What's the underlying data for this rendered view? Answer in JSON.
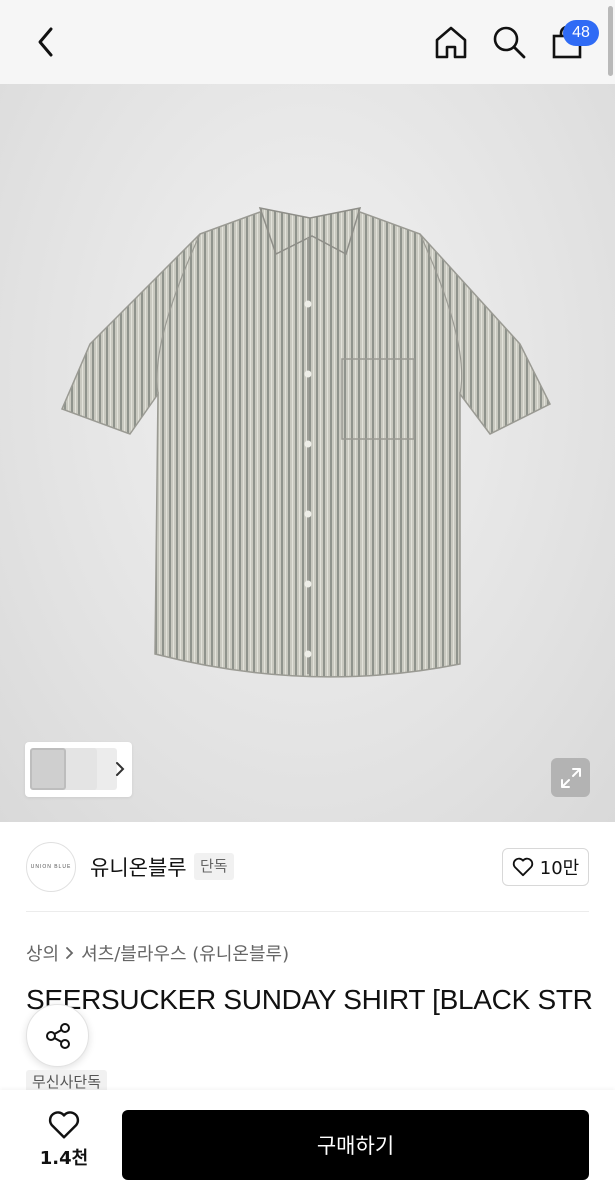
{
  "header": {
    "cart_count": "48",
    "icons": [
      "back-icon",
      "home-icon",
      "search-icon",
      "cart-icon"
    ]
  },
  "gallery": {
    "expand_icon": "expand-icon"
  },
  "brand": {
    "logo_text": "UNION BLUE",
    "name": "유니온블루",
    "tag": "단독",
    "like_count": "10만"
  },
  "product": {
    "breadcrumb": [
      "상의",
      "셔츠/블라우스 (유니온블루)"
    ],
    "title": "SEERSUCKER SUNDAY SHIRT [BLACK STR",
    "tag": "무신사단독"
  },
  "bottom": {
    "wish_count": "1.4천",
    "buy_label": "구매하기"
  },
  "colors": {
    "badge": "#2f6bf5",
    "buy_button": "#000000"
  }
}
